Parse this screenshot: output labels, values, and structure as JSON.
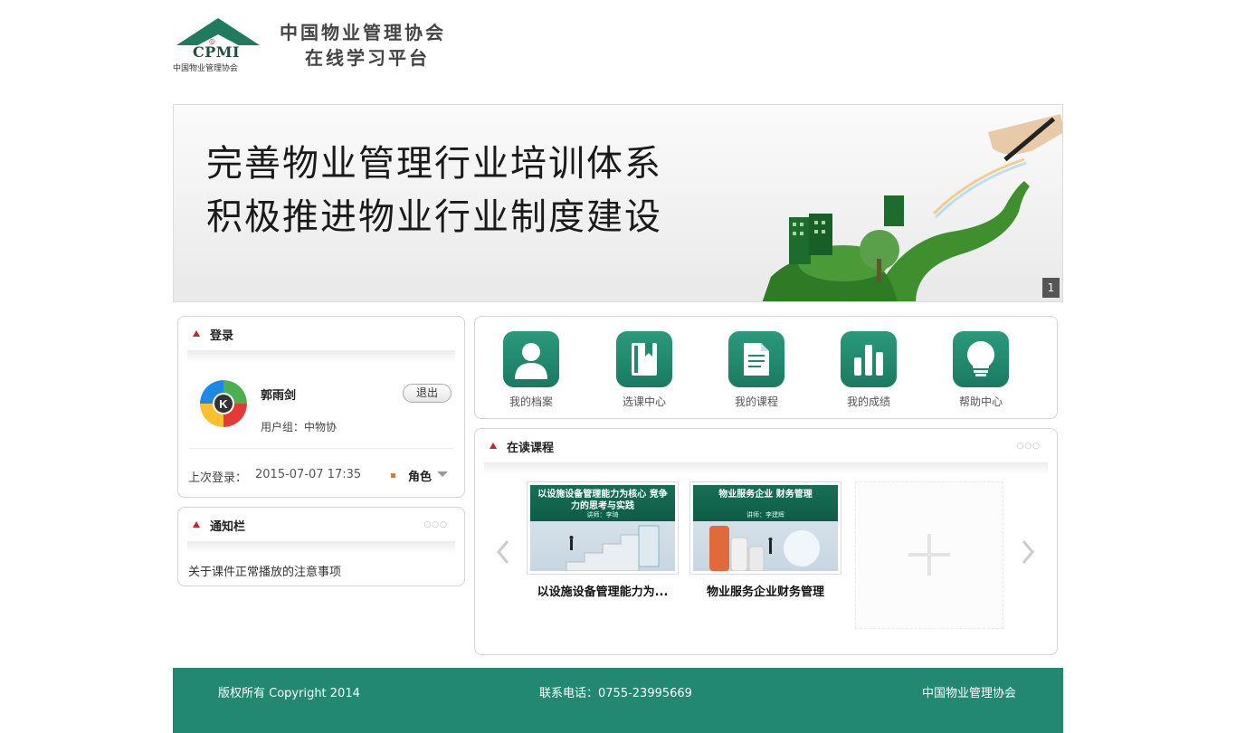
{
  "header": {
    "logo_text": "CPMI",
    "logo_sub": "中国物业管理协会",
    "title_line1": "中国物业管理协会",
    "title_line2": "在线学习平台"
  },
  "banner": {
    "line1": "完善物业管理行业培训体系",
    "line2": "积极推进物业行业制度建设",
    "page": "1"
  },
  "login": {
    "title": "登录",
    "username": "郭雨剑",
    "logout_label": "退出",
    "usergroup": "用户组：中物协",
    "last_login_label": "上次登录：",
    "last_login_value": "2015-07-07 17:35",
    "role_label": "角色"
  },
  "notice": {
    "title": "通知栏",
    "items": [
      "关于课件正常播放的注意事项"
    ]
  },
  "quicknav": {
    "items": [
      {
        "label": "我的档案",
        "icon": "profile-icon"
      },
      {
        "label": "选课中心",
        "icon": "book-icon"
      },
      {
        "label": "我的课程",
        "icon": "document-icon"
      },
      {
        "label": "我的成绩",
        "icon": "bar-chart-icon"
      },
      {
        "label": "帮助中心",
        "icon": "lightbulb-icon"
      }
    ]
  },
  "courses": {
    "title": "在读课程",
    "items": [
      {
        "name": "以设施设备管理能力为...",
        "thumb_title": "以设施设备管理能力为核心 竞争力的思考与实践",
        "thumb_sub": "讲师：李琦"
      },
      {
        "name": "物业服务企业财务管理",
        "thumb_title": "物业服务企业 财务管理",
        "thumb_sub": "讲师：李建辉"
      }
    ]
  },
  "footer": {
    "copyright": "版权所有 Copyright 2014",
    "phone": "联系电话：0755-23995669",
    "org": "中国物业管理协会"
  },
  "colors": {
    "brand_green": "#228871",
    "icon_green": "#1f8a6c",
    "accent_red": "#c0272d",
    "accent_orange": "#e07a22"
  }
}
